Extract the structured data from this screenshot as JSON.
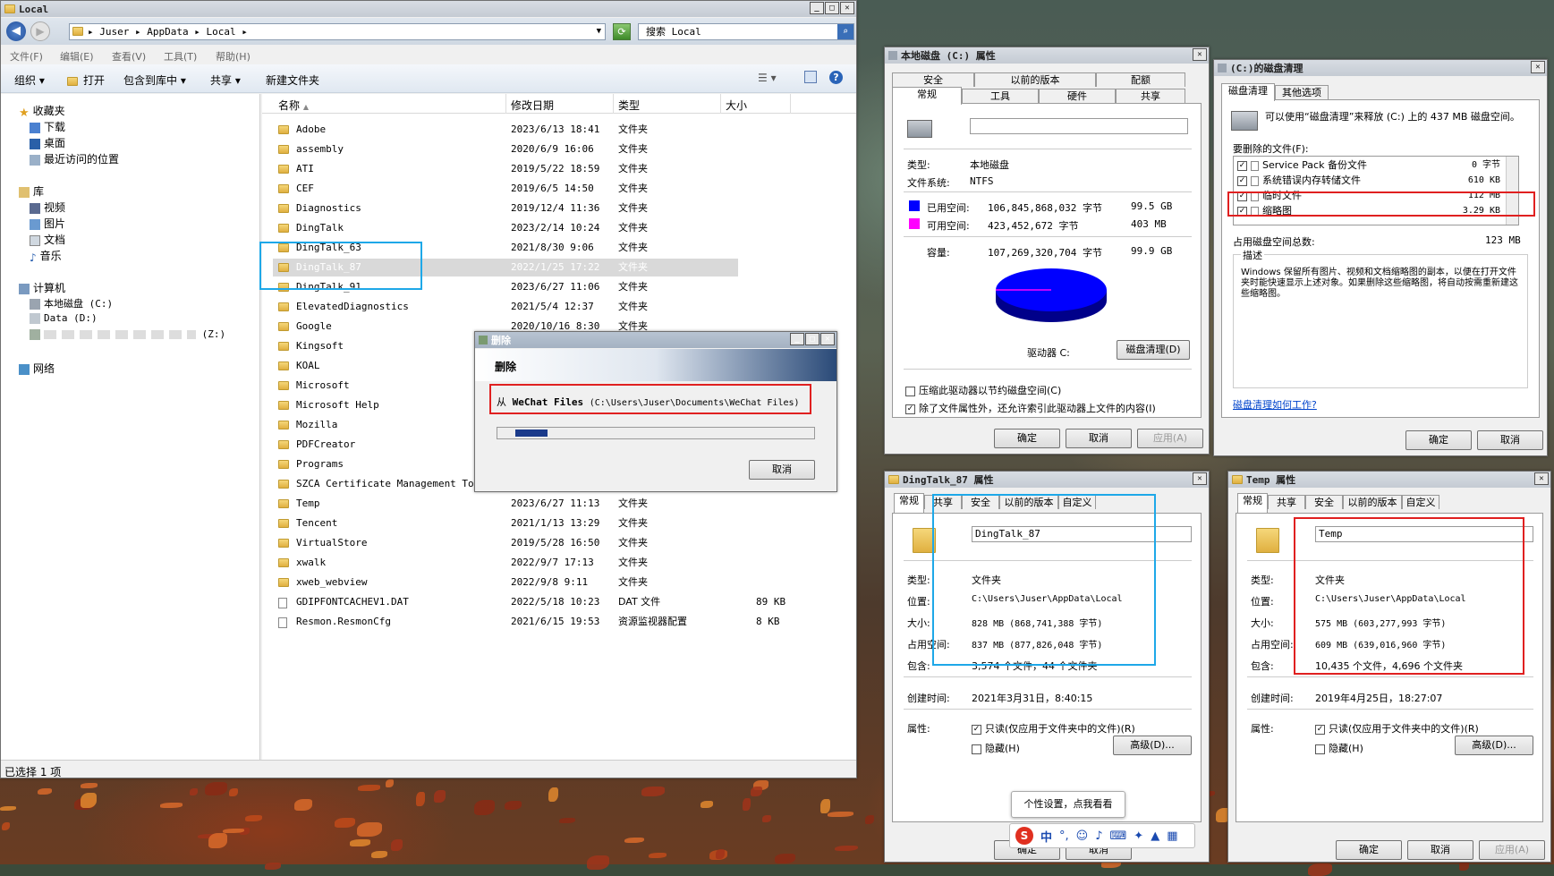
{
  "explorer": {
    "title": "Local",
    "breadcrumb": [
      "Juser",
      "AppData",
      "Local"
    ],
    "search_placeholder": "搜索 Local",
    "menu": [
      "文件(F)",
      "编辑(E)",
      "查看(V)",
      "工具(T)",
      "帮助(H)"
    ],
    "toolbar": [
      "组织",
      "打开",
      "包含到库中",
      "共享",
      "新建文件夹"
    ],
    "columns": [
      "名称",
      "修改日期",
      "类型",
      "大小"
    ],
    "nav": {
      "favorites": "收藏夹",
      "fav_items": [
        "下载",
        "桌面",
        "最近访问的位置"
      ],
      "library": "库",
      "lib_items": [
        "视频",
        "图片",
        "文档",
        "音乐"
      ],
      "computer": "计算机",
      "comp_items": [
        "本地磁盘 (C:)",
        "Data (D:)",
        "(Z:)"
      ],
      "network": "网络"
    },
    "rows": [
      {
        "name": "Adobe",
        "date": "2023/6/13 18:41",
        "type": "文件夹",
        "size": ""
      },
      {
        "name": "assembly",
        "date": "2020/6/9 16:06",
        "type": "文件夹",
        "size": ""
      },
      {
        "name": "ATI",
        "date": "2019/5/22 18:59",
        "type": "文件夹",
        "size": ""
      },
      {
        "name": "CEF",
        "date": "2019/6/5 14:50",
        "type": "文件夹",
        "size": ""
      },
      {
        "name": "Diagnostics",
        "date": "2019/12/4 11:36",
        "type": "文件夹",
        "size": ""
      },
      {
        "name": "DingTalk",
        "date": "2023/2/14 10:24",
        "type": "文件夹",
        "size": ""
      },
      {
        "name": "DingTalk_63",
        "date": "2021/8/30 9:06",
        "type": "文件夹",
        "size": ""
      },
      {
        "name": "DingTalk_87",
        "date": "2022/1/25 17:22",
        "type": "文件夹",
        "size": ""
      },
      {
        "name": "DingTalk_91",
        "date": "2023/6/27 11:06",
        "type": "文件夹",
        "size": ""
      },
      {
        "name": "ElevatedDiagnostics",
        "date": "2021/5/4 12:37",
        "type": "文件夹",
        "size": ""
      },
      {
        "name": "Google",
        "date": "2020/10/16 8:30",
        "type": "文件夹",
        "size": ""
      },
      {
        "name": "Kingsoft",
        "date": "",
        "type": "",
        "size": ""
      },
      {
        "name": "KOAL",
        "date": "",
        "type": "",
        "size": ""
      },
      {
        "name": "Microsoft",
        "date": "",
        "type": "",
        "size": ""
      },
      {
        "name": "Microsoft Help",
        "date": "",
        "type": "",
        "size": ""
      },
      {
        "name": "Mozilla",
        "date": "",
        "type": "",
        "size": ""
      },
      {
        "name": "PDFCreator",
        "date": "",
        "type": "",
        "size": ""
      },
      {
        "name": "Programs",
        "date": "",
        "type": "",
        "size": ""
      },
      {
        "name": "SZCA Certificate Management Tool",
        "date": "",
        "type": "",
        "size": ""
      },
      {
        "name": "Temp",
        "date": "2023/6/27 11:13",
        "type": "文件夹",
        "size": ""
      },
      {
        "name": "Tencent",
        "date": "2021/1/13 13:29",
        "type": "文件夹",
        "size": ""
      },
      {
        "name": "VirtualStore",
        "date": "2019/5/28 16:50",
        "type": "文件夹",
        "size": ""
      },
      {
        "name": "xwalk",
        "date": "2022/9/7 17:13",
        "type": "文件夹",
        "size": ""
      },
      {
        "name": "xweb_webview",
        "date": "2022/9/8 9:11",
        "type": "文件夹",
        "size": ""
      },
      {
        "name": "GDIPFONTCACHEV1.DAT",
        "date": "2022/5/18 10:23",
        "type": "DAT 文件",
        "size": "89 KB"
      },
      {
        "name": "Resmon.ResmonCfg",
        "date": "2021/6/15 19:53",
        "type": "资源监视器配置",
        "size": "8 KB"
      }
    ],
    "status": "已选择 1 项"
  },
  "delete_dialog": {
    "title": "删除",
    "heading": "删除",
    "from_label": "从",
    "name": "WeChat Files",
    "path": "(C:\\Users\\Juser\\Documents\\WeChat Files)",
    "progress": 0.12,
    "cancel": "取消"
  },
  "disk_props": {
    "title": "本地磁盘 (C:) 属性",
    "tabs_top": [
      "安全",
      "以前的版本",
      "配额"
    ],
    "tabs_bottom": [
      "常规",
      "工具",
      "硬件",
      "共享"
    ],
    "type_label": "类型:",
    "type_value": "本地磁盘",
    "fs_label": "文件系统:",
    "fs_value": "NTFS",
    "used_label": "已用空间:",
    "used_bytes": "106,845,868,032 字节",
    "used_gb": "99.5 GB",
    "free_label": "可用空间:",
    "free_bytes": "423,452,672 字节",
    "free_mb": "403 MB",
    "cap_label": "容量:",
    "cap_bytes": "107,269,320,704 字节",
    "cap_gb": "99.9 GB",
    "used_color": "#0000ff",
    "free_color": "#ff00ff",
    "used_fraction": 0.996,
    "drive_label": "驱动器 C:",
    "cleanup_btn": "磁盘清理(D)",
    "compress": "压缩此驱动器以节约磁盘空间(C)",
    "index": "除了文件属性外，还允许索引此驱动器上文件的内容(I)",
    "ok": "确定",
    "cancel": "取消",
    "apply": "应用(A)"
  },
  "cleanup": {
    "title": "(C:)的磁盘清理",
    "tabs": [
      "磁盘清理",
      "其他选项"
    ],
    "intro": "可以使用“磁盘清理”来释放 (C:) 上的 437 MB 磁盘空间。",
    "files_label": "要删除的文件(F):",
    "items": [
      {
        "name": "Service Pack 备份文件",
        "size": "0 字节"
      },
      {
        "name": "系统错误内存转储文件",
        "size": "610 KB"
      },
      {
        "name": "临时文件",
        "size": "112 MB"
      },
      {
        "name": "缩略图",
        "size": "3.29 KB"
      }
    ],
    "total_label": "占用磁盘空间总数:",
    "total": "123 MB",
    "desc_label": "描述",
    "desc": "Windows 保留所有图片、视频和文档缩略图的副本，以便在打开文件夹时能快速显示上述对象。如果删除这些缩略图，将自动按需重新建这些缩略图。",
    "link": "磁盘清理如何工作?",
    "ok": "确定",
    "cancel": "取消"
  },
  "ding_props": {
    "title": "DingTalk_87 属性",
    "tabs": [
      "常规",
      "共享",
      "安全",
      "以前的版本",
      "自定义"
    ],
    "name": "DingTalk_87",
    "type_label": "类型:",
    "type": "文件夹",
    "loc_label": "位置:",
    "loc": "C:\\Users\\Juser\\AppData\\Local",
    "size_label": "大小:",
    "size": "828 MB (868,741,388 字节)",
    "disk_label": "占用空间:",
    "disk": "837 MB (877,826,048 字节)",
    "contains_label": "包含:",
    "contains": "3,574 个文件，44 个文件夹",
    "created_label": "创建时间:",
    "created": "2021年3月31日，8:40:15",
    "attr_label": "属性:",
    "readonly": "只读(仅应用于文件夹中的文件)(R)",
    "hidden": "隐藏(H)",
    "advanced": "高级(D)...",
    "ok": "确定",
    "cancel": "取消"
  },
  "temp_props": {
    "title": "Temp 属性",
    "tabs": [
      "常规",
      "共享",
      "安全",
      "以前的版本",
      "自定义"
    ],
    "name": "Temp",
    "type_label": "类型:",
    "type": "文件夹",
    "loc_label": "位置:",
    "loc": "C:\\Users\\Juser\\AppData\\Local",
    "size_label": "大小:",
    "size": "575 MB (603,277,993 字节)",
    "disk_label": "占用空间:",
    "disk": "609 MB (639,016,960 字节)",
    "contains_label": "包含:",
    "contains": "10,435 个文件，4,696 个文件夹",
    "created_label": "创建时间:",
    "created": "2019年4月25日，18:27:07",
    "attr_label": "属性:",
    "readonly": "只读(仅应用于文件夹中的文件)(R)",
    "hidden": "隐藏(H)",
    "advanced": "高级(D)...",
    "ok": "确定",
    "cancel": "取消",
    "apply": "应用(A)"
  },
  "ime": {
    "tooltip": "个性设置，点我看看",
    "lang": "中"
  },
  "colors": {
    "red_box": "#e02020",
    "blue_box": "#1ea8e8",
    "selection": "#d9d9d9"
  }
}
